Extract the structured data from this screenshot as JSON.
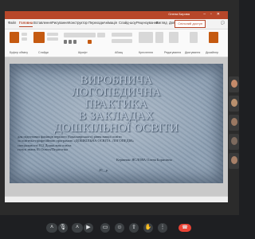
{
  "ppt": {
    "user_name": "Олена Бирова",
    "menu": [
      "Файл",
      "Головна",
      "Вставлення",
      "Рисування",
      "Конструктор",
      "Переходи",
      "Анімація",
      "Слайд-шоу",
      "Рецензування",
      "Вигляд",
      "Довідка"
    ],
    "share_label": "Спільний доступ",
    "comments_label": "Примітки",
    "ribbon_labels": [
      "Буфер обміну",
      "Слайди",
      "Шрифт",
      "Абзац",
      "Креслення",
      "Редагування",
      "Диктування",
      "Дизайнер"
    ]
  },
  "slide": {
    "title_lines": [
      "ВИРОБНИЧА",
      "ЛОГОПЕДИЧНА ПРАКТИКА",
      "В ЗАКЛАДАХ",
      "ДОШКІЛЬНОЇ ОСВІТИ"
    ],
    "body_lines": [
      "для підготовки фахівців першого (бакалаврського) рівня вищої освіти",
      "за освітньо-професійною програмою «ДОШКІЛЬНА ОСВІТА. ЛОГОПЕДІЯ»",
      "спеціальності 012 Дошкільна освіта",
      "галузі знань 01 Освіта/Педагогіка"
    ],
    "author": "Керівник: ЯСЛОВА Олена Борисівна",
    "year": "20__р."
  },
  "toolbar": {
    "icons": [
      "chevron-up-icon",
      "mic-icon",
      "chevron-up-icon",
      "camera-icon",
      "captions-icon",
      "emoji-icon",
      "present-icon",
      "raise-hand-icon",
      "more-icon",
      "hangup-icon"
    ]
  }
}
